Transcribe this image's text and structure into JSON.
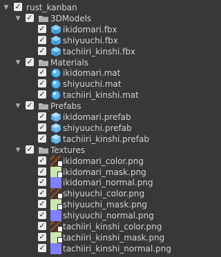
{
  "root": {
    "label": "rust_kanban",
    "checked": true,
    "expanded": true
  },
  "folders": [
    {
      "label": "3DModels",
      "checked": true,
      "expanded": true,
      "items": [
        {
          "label": "ikidomari.fbx",
          "icon": "model-icon",
          "checked": true
        },
        {
          "label": "shiyuuchi.fbx",
          "icon": "model-icon",
          "checked": true
        },
        {
          "label": "tachiiri_kinshi.fbx",
          "icon": "model-icon",
          "checked": true
        }
      ]
    },
    {
      "label": "Materials",
      "checked": true,
      "expanded": true,
      "items": [
        {
          "label": "ikidomari.mat",
          "icon": "material-icon",
          "checked": true
        },
        {
          "label": "shiyuuchi.mat",
          "icon": "material-icon",
          "checked": true
        },
        {
          "label": "tachiiri_kinshi.mat",
          "icon": "material-icon",
          "checked": true
        }
      ]
    },
    {
      "label": "Prefabs",
      "checked": true,
      "expanded": true,
      "items": [
        {
          "label": "ikidomari.prefab",
          "icon": "prefab-icon",
          "checked": true
        },
        {
          "label": "shiyuuchi.prefab",
          "icon": "prefab-icon",
          "checked": true
        },
        {
          "label": "tachiiri_kinshi.prefab",
          "icon": "prefab-icon",
          "checked": true
        }
      ]
    },
    {
      "label": "Textures",
      "checked": true,
      "expanded": true,
      "items": [
        {
          "label": "ikidomari_color.png",
          "icon": "texture-color-icon",
          "checked": true
        },
        {
          "label": "ikidomari_mask.png",
          "icon": "texture-mask-icon",
          "checked": true
        },
        {
          "label": "ikidomari_normal.png",
          "icon": "texture-normal-icon",
          "checked": true
        },
        {
          "label": "shiyuuchi_color.png",
          "icon": "texture-color-icon",
          "checked": true
        },
        {
          "label": "shiyuuchi_mask.png",
          "icon": "texture-mask-icon",
          "checked": true
        },
        {
          "label": "shiyuuchi_normal.png",
          "icon": "texture-normal-icon",
          "checked": true
        },
        {
          "label": "tachiiri_kinshi_color.png",
          "icon": "texture-color-icon",
          "checked": true
        },
        {
          "label": "tachiiri_kinshi_mask.png",
          "icon": "texture-mask-icon",
          "checked": true
        },
        {
          "label": "tachiiri_kinshi_normal.png",
          "icon": "texture-normal-icon",
          "checked": true
        }
      ]
    }
  ],
  "colors": {
    "background": "#383838",
    "text": "#d2d2d2",
    "checkbox": "#ebebeb",
    "folder": "#c2c2c2",
    "model": "#4aa3df",
    "material": "#5bb8ee",
    "normal_map": "#8080ff",
    "mask_map": "#cfe6b2"
  }
}
